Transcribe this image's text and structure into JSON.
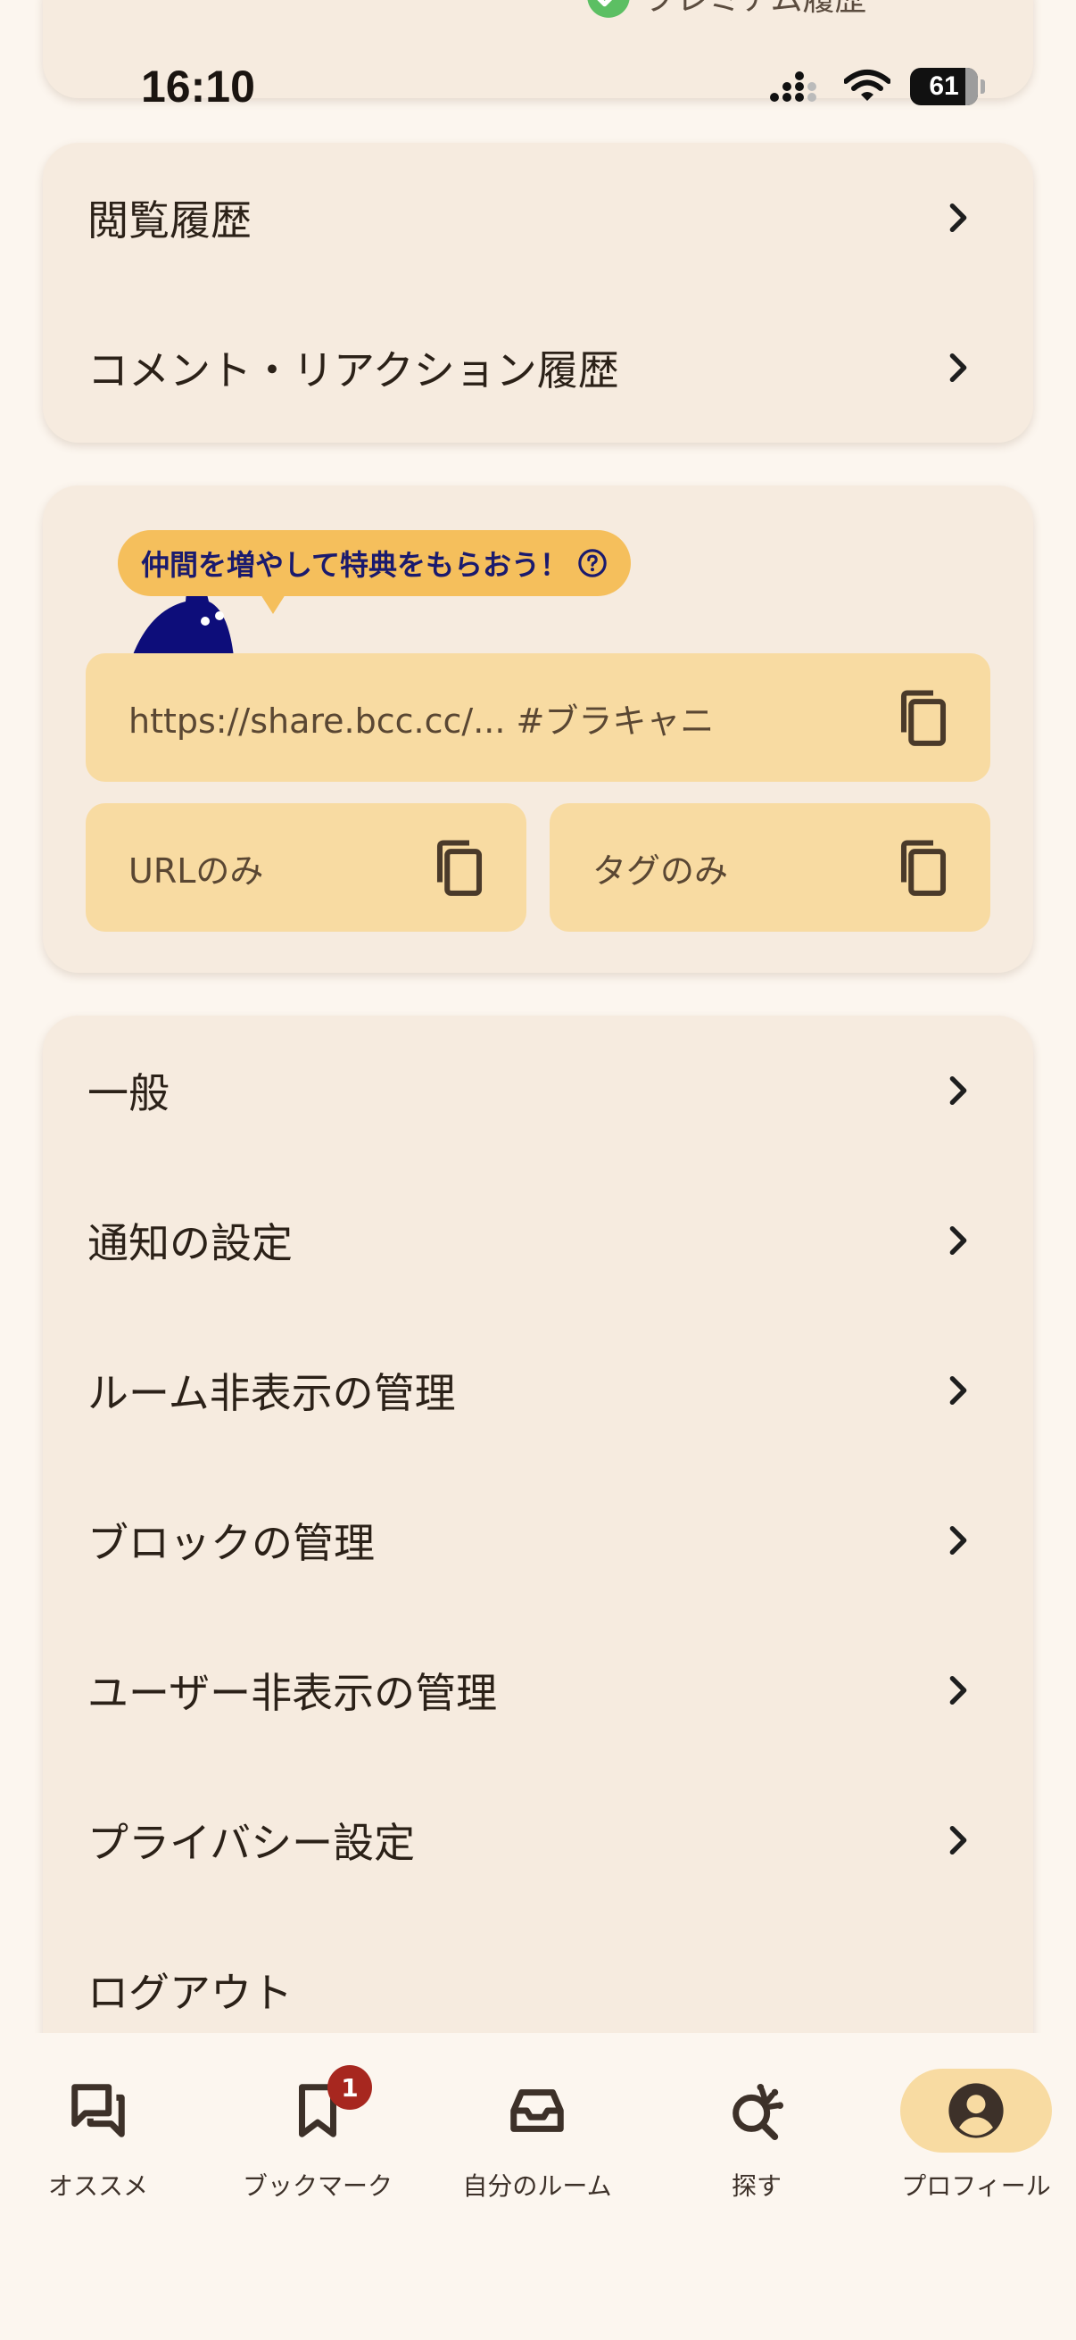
{
  "status_bar": {
    "time": "16:10",
    "battery": "61"
  },
  "premium": {
    "label": "プレミアム履歴"
  },
  "history_menu": [
    {
      "label": "閲覧履歴"
    },
    {
      "label": "コメント・リアクション履歴"
    }
  ],
  "share": {
    "invite_text": "仲間を増やして特典をもらおう！",
    "full_text": "https://share.bcc.cc/... #ブラキャニ",
    "url_only": "URLのみ",
    "tag_only": "タグのみ"
  },
  "settings_menu": [
    {
      "label": "一般"
    },
    {
      "label": "通知の設定"
    },
    {
      "label": "ルーム非表示の管理"
    },
    {
      "label": "ブロックの管理"
    },
    {
      "label": "ユーザー非表示の管理"
    },
    {
      "label": "プライバシー設定"
    },
    {
      "label": "ログアウト"
    }
  ],
  "bottom_nav": [
    {
      "label": "オススメ",
      "icon": "chat-icon"
    },
    {
      "label": "ブックマーク",
      "icon": "bookmark-icon",
      "badge": "1"
    },
    {
      "label": "自分のルーム",
      "icon": "inbox-icon"
    },
    {
      "label": "探す",
      "icon": "search-explore-icon"
    },
    {
      "label": "プロフィール",
      "icon": "account-icon",
      "active": true
    }
  ],
  "colors": {
    "background": "#fcf6ef",
    "card": "#f6ebdf",
    "accent_light": "#f8dba2",
    "accent": "#f5bf5c",
    "badge": "#a7271f",
    "mascot": "#0d0d7a"
  }
}
